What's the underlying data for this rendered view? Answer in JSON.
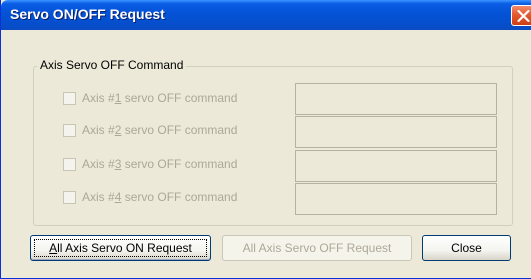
{
  "window": {
    "title": "Servo ON/OFF Request",
    "close_icon": "close-icon"
  },
  "group": {
    "label": "Axis Servo OFF Command",
    "items": [
      {
        "label_prefix": "Axis #",
        "label_accel": "1",
        "label_suffix": " servo OFF command",
        "checked": false,
        "enabled": false,
        "value": ""
      },
      {
        "label_prefix": "Axis #",
        "label_accel": "2",
        "label_suffix": " servo OFF command",
        "checked": false,
        "enabled": false,
        "value": ""
      },
      {
        "label_prefix": "Axis #",
        "label_accel": "3",
        "label_suffix": " servo OFF command",
        "checked": false,
        "enabled": false,
        "value": ""
      },
      {
        "label_prefix": "Axis #",
        "label_accel": "4",
        "label_suffix": " servo OFF command",
        "checked": false,
        "enabled": false,
        "value": ""
      }
    ]
  },
  "buttons": {
    "all_on": {
      "accel": "A",
      "rest": "ll Axis Servo ON Request",
      "enabled": true
    },
    "all_off": {
      "label": "All Axis Servo OFF Request",
      "enabled": false
    },
    "close": {
      "label": "Close",
      "enabled": true
    }
  },
  "colors": {
    "titlebar": "#0553d8",
    "face": "#ece9d8",
    "disabled_text": "#aca899"
  }
}
